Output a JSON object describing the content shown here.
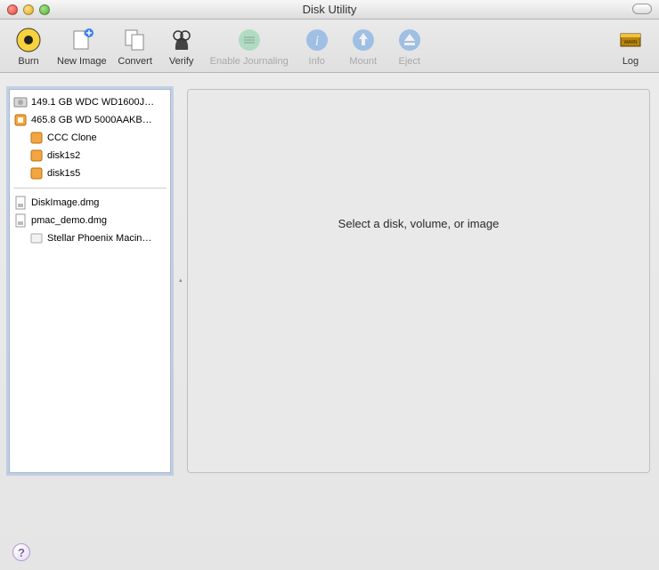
{
  "window": {
    "title": "Disk Utility"
  },
  "toolbar": {
    "burn": "Burn",
    "newimage": "New Image",
    "convert": "Convert",
    "verify": "Verify",
    "enablejournal": "Enable Journaling",
    "info": "Info",
    "mount": "Mount",
    "eject": "Eject",
    "log": "Log"
  },
  "sidebar": {
    "disks": [
      {
        "label": "149.1 GB WDC WD1600J…",
        "type": "internal"
      },
      {
        "label": "465.8 GB WD 5000AAKB…",
        "type": "external",
        "children": [
          {
            "label": "CCC Clone",
            "type": "volume-ext"
          },
          {
            "label": "disk1s2",
            "type": "volume-ext"
          },
          {
            "label": "disk1s5",
            "type": "volume-ext"
          }
        ]
      }
    ],
    "images": [
      {
        "label": "DiskImage.dmg",
        "type": "dmg"
      },
      {
        "label": "pmac_demo.dmg",
        "type": "dmg",
        "children": [
          {
            "label": "Stellar Phoenix Macin…",
            "type": "mounted"
          }
        ]
      }
    ]
  },
  "detail": {
    "placeholder": "Select a disk, volume, or image"
  },
  "help_glyph": "?"
}
